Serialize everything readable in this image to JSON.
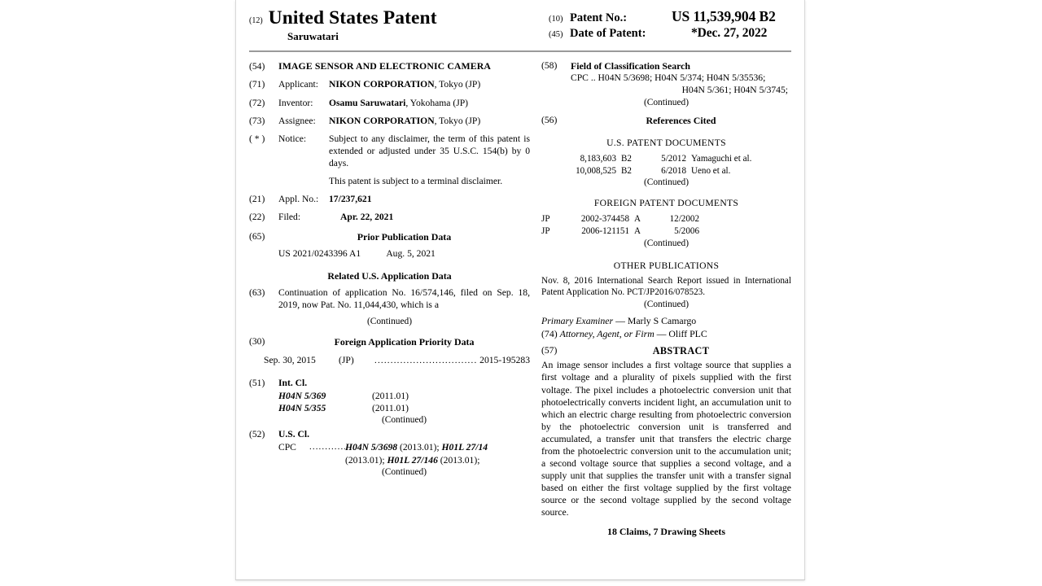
{
  "document": {
    "kind_code_12": "(12)",
    "title": "United States Patent",
    "inventor_surname": "Saruwatari",
    "patent_no_code": "(10)",
    "patent_no_label": "Patent No.:",
    "patent_no_value": "US 11,539,904 B2",
    "date_code": "(45)",
    "date_label": "Date of Patent:",
    "date_value": "*Dec. 27, 2022"
  },
  "left": {
    "title_code": "(54)",
    "title_text": "IMAGE SENSOR AND ELECTRONIC CAMERA",
    "applicant_code": "(71)",
    "applicant_label": "Applicant:",
    "applicant_name": "NIKON CORPORATION",
    "applicant_rest": ", Tokyo (JP)",
    "inventor_code": "(72)",
    "inventor_label": "Inventor:",
    "inventor_name": "Osamu Saruwatari",
    "inventor_rest": ", Yokohama (JP)",
    "assignee_code": "(73)",
    "assignee_label": "Assignee:",
    "assignee_name": "NIKON CORPORATION",
    "assignee_rest": ", Tokyo (JP)",
    "notice_code": "( * )",
    "notice_label": "Notice:",
    "notice_text": "Subject to any disclaimer, the term of this patent is extended or adjusted under 35 U.S.C. 154(b) by 0 days.",
    "notice_text2": "This patent is subject to a terminal disclaimer.",
    "applno_code": "(21)",
    "applno_label": "Appl. No.:",
    "applno_value": "17/237,621",
    "filed_code": "(22)",
    "filed_label": "Filed:",
    "filed_value": "Apr. 22, 2021",
    "prior_pub_code": "(65)",
    "prior_pub_head": "Prior Publication Data",
    "prior_pub_number": "US 2021/0243396 A1",
    "prior_pub_date": "Aug. 5, 2021",
    "related_head": "Related U.S. Application Data",
    "related_code": "(63)",
    "related_text": "Continuation of application No. 16/574,146, filed on Sep. 18, 2019, now Pat. No. 11,044,430, which is a",
    "related_continued": "(Continued)",
    "foreign_code": "(30)",
    "foreign_head": "Foreign Application Priority Data",
    "foreign_date": "Sep. 30, 2015",
    "foreign_cc": "(JP)",
    "foreign_dots": "..................................",
    "foreign_number": "2015-195283",
    "intcl_code": "(51)",
    "intcl_label": "Int. Cl.",
    "intcl_rows": [
      {
        "cls": "H04N 5/369",
        "ver": "(2011.01)"
      },
      {
        "cls": "H04N 5/355",
        "ver": "(2011.01)"
      }
    ],
    "intcl_continued": "(Continued)",
    "uscl_code": "(52)",
    "uscl_label": "U.S. Cl.",
    "uscl_cpc": "CPC",
    "uscl_dots": "............",
    "uscl_line1_a": "H04N 5/3698",
    "uscl_line1_b": " (2013.01); ",
    "uscl_line1_c": "H01L 27/14",
    "uscl_line2_a": "(2013.01); ",
    "uscl_line2_b": "H01L 27/146",
    "uscl_line2_c": " (2013.01);",
    "uscl_continued": "(Continued)"
  },
  "right": {
    "fcs_code": "(58)",
    "fcs_head": "Field of Classification Search",
    "fcs_cpc": "CPC",
    "fcs_dots": "..",
    "fcs_line1": "H04N 5/3698; H04N 5/374; H04N 5/35536;",
    "fcs_line2": "H04N 5/361; H04N 5/3745;",
    "fcs_continued": "(Continued)",
    "refs_code": "(56)",
    "refs_head": "References Cited",
    "us_docs_head": "U.S. PATENT DOCUMENTS",
    "us_docs": [
      {
        "number": "8,183,603",
        "kind": "B2",
        "date": "5/2012",
        "name": "Yamaguchi et al."
      },
      {
        "number": "10,008,525",
        "kind": "B2",
        "date": "6/2018",
        "name": "Ueno et al."
      }
    ],
    "us_docs_continued": "(Continued)",
    "foreign_docs_head": "FOREIGN PATENT DOCUMENTS",
    "foreign_docs": [
      {
        "cc": "JP",
        "number": "2002-374458",
        "kind": "A",
        "date": "12/2002"
      },
      {
        "cc": "JP",
        "number": "2006-121151",
        "kind": "A",
        "date": "5/2006"
      }
    ],
    "foreign_docs_continued": "(Continued)",
    "other_pub_head": "OTHER PUBLICATIONS",
    "other_pub_text": "Nov. 8, 2016 International Search Report issued in International Patent Application No. PCT/JP2016/078523.",
    "other_pub_continued": "(Continued)",
    "primary_examiner_label": "Primary Examiner",
    "primary_examiner_name": " — Marly S Camargo",
    "attorney_code": "(74)",
    "attorney_label": "Attorney, Agent, or Firm",
    "attorney_name": " — Oliff PLC",
    "abstract_code": "(57)",
    "abstract_head": "ABSTRACT",
    "abstract_text": "An image sensor includes a first voltage source that supplies a first voltage and a plurality of pixels supplied with the first voltage. The pixel includes a photoelectric conversion unit that photoelectrically converts incident light, an accumulation unit to which an electric charge resulting from photoelectric conversion by the photoelectric conversion unit is transferred and accumulated, a transfer unit that transfers the electric charge from the photoelectric conversion unit to the accumulation unit; a second voltage source that supplies a second voltage, and a supply unit that supplies the transfer unit with a transfer signal based on either the first voltage supplied by the first voltage source or the second voltage supplied by the second voltage source.",
    "claims_line": "18 Claims, 7 Drawing Sheets"
  },
  "colors": {
    "page_background": "#ffffff",
    "text": "#000000",
    "rule": "#9a9a9a",
    "page_border": "#d8d8d8"
  }
}
